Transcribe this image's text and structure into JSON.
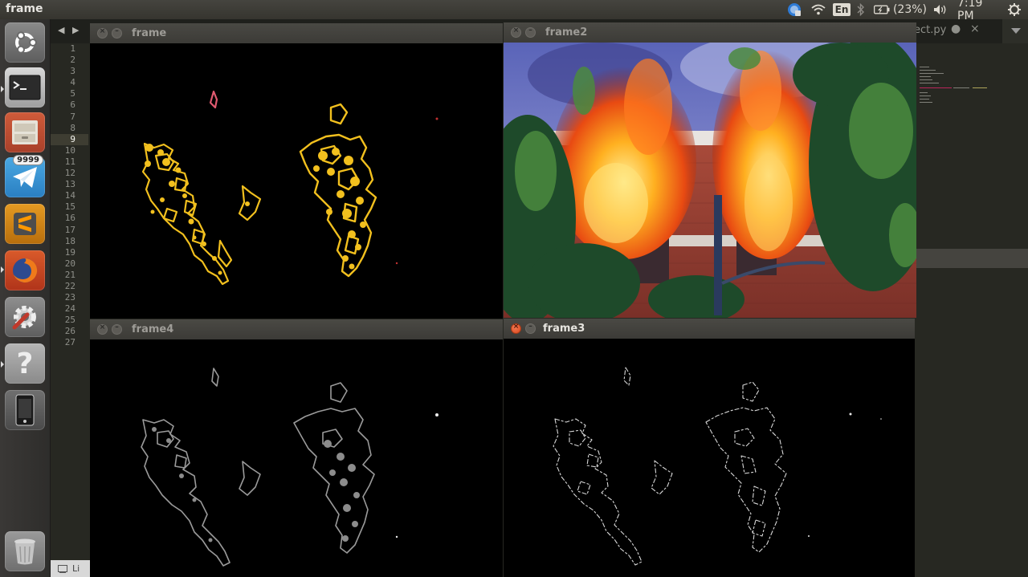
{
  "topbar": {
    "app_title": "frame",
    "keyboard_layout": "En",
    "battery": "(23%)",
    "clock": "7:19 PM"
  },
  "launcher": {
    "items": [
      {
        "name": "ubuntu-dash",
        "icon": "ubuntu-logo-icon"
      },
      {
        "name": "terminal",
        "icon": "terminal-icon"
      },
      {
        "name": "files",
        "icon": "file-cabinet-icon"
      },
      {
        "name": "telegram",
        "icon": "paper-plane-icon",
        "badge": "9999"
      },
      {
        "name": "sublime-text",
        "icon": "sublime-s-icon"
      },
      {
        "name": "firefox",
        "icon": "firefox-icon"
      },
      {
        "name": "system-settings",
        "icon": "gear-wrench-icon"
      },
      {
        "name": "help",
        "icon": "question-mark-icon",
        "glyph": "?"
      },
      {
        "name": "phone",
        "icon": "phone-icon"
      },
      {
        "name": "trash",
        "icon": "trash-icon"
      }
    ]
  },
  "editor": {
    "nav": "◀ ▶",
    "tab_name": "ect.py",
    "tab_dot": "●",
    "tab_close": "×",
    "line_numbers": [
      "1",
      "2",
      "3",
      "4",
      "5",
      "6",
      "7",
      "8",
      "9",
      "10",
      "11",
      "12",
      "13",
      "14",
      "15",
      "16",
      "17",
      "18",
      "19",
      "20",
      "21",
      "22",
      "23",
      "24",
      "25",
      "26",
      "27"
    ],
    "current_line": 9,
    "status_chip": "Li"
  },
  "windows": {
    "frame": {
      "title": "frame",
      "close_glyph": "×",
      "min_glyph": "–"
    },
    "frame2": {
      "title": "frame2",
      "close_glyph": "×",
      "min_glyph": "–"
    },
    "frame4": {
      "title": "frame4",
      "close_glyph": "×",
      "min_glyph": "–"
    },
    "frame3": {
      "title": "frame3",
      "close_glyph": "×",
      "min_glyph": "–"
    }
  },
  "colors": {
    "fire_mask": "#f2c01e",
    "edge_gray": "#9a9a9a",
    "edge_white": "#d8d8d8",
    "ubuntu_accent": "#e95420",
    "aubergine": "#300a24"
  }
}
